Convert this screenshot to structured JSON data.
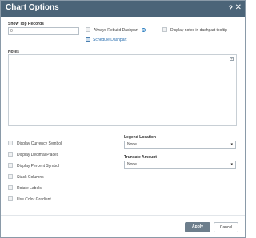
{
  "dialog": {
    "title": "Chart Options",
    "help_glyph": "?",
    "close_glyph": "✕"
  },
  "show_top_records": {
    "label": "Show Top Records",
    "value": "0"
  },
  "options": {
    "always_rebuild": "Always Rebuild Dashpart",
    "info_glyph": "i",
    "display_notes_tooltip": "Display notes in dashpart tooltip",
    "schedule_link": "Schedule Dashpart"
  },
  "notes": {
    "label": "Notes",
    "expand_glyph": "+"
  },
  "checkboxes": [
    "Display Currency Symbol",
    "Display Decimal Places",
    "Display Percent Symbol",
    "Stack Columns",
    "Rotate Labels",
    "Use Color Gradient"
  ],
  "legend_location": {
    "label": "Legend Location",
    "value": "None"
  },
  "truncate_amount": {
    "label": "Truncate Amount",
    "value": "None"
  },
  "chevron_glyph": "▾",
  "footer": {
    "apply": "Apply",
    "cancel": "Cancel"
  }
}
